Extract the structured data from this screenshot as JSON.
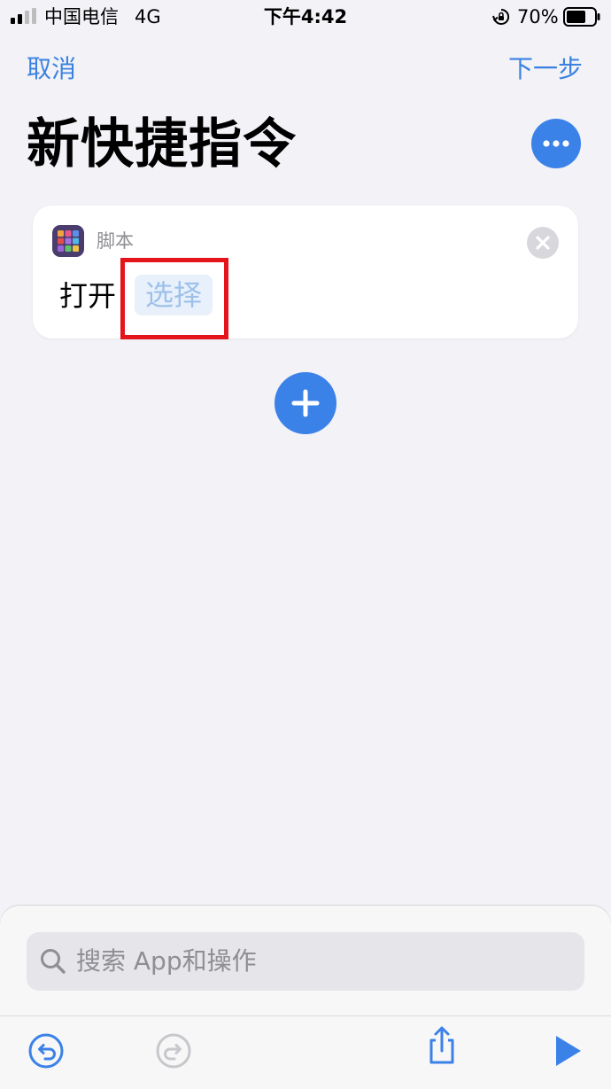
{
  "status_bar": {
    "carrier": "中国电信",
    "network": "4G",
    "time": "下午4:42",
    "battery_percent": "70%",
    "battery_level": 0.7
  },
  "nav": {
    "cancel_label": "取消",
    "next_label": "下一步"
  },
  "page": {
    "title": "新快捷指令"
  },
  "action_card": {
    "category": "脚本",
    "verb": "打开",
    "parameter_placeholder": "选择"
  },
  "search": {
    "placeholder": "搜索 App和操作"
  },
  "colors": {
    "accent": "#3b82e8",
    "highlight": "#e3151a",
    "background": "#f2f2f7"
  },
  "icons": {
    "more": "ellipsis-icon",
    "add": "plus-icon",
    "close": "close-icon",
    "search": "search-icon",
    "undo": "undo-icon",
    "redo": "redo-icon",
    "share": "share-icon",
    "run": "play-icon",
    "app": "scripting-icon"
  }
}
